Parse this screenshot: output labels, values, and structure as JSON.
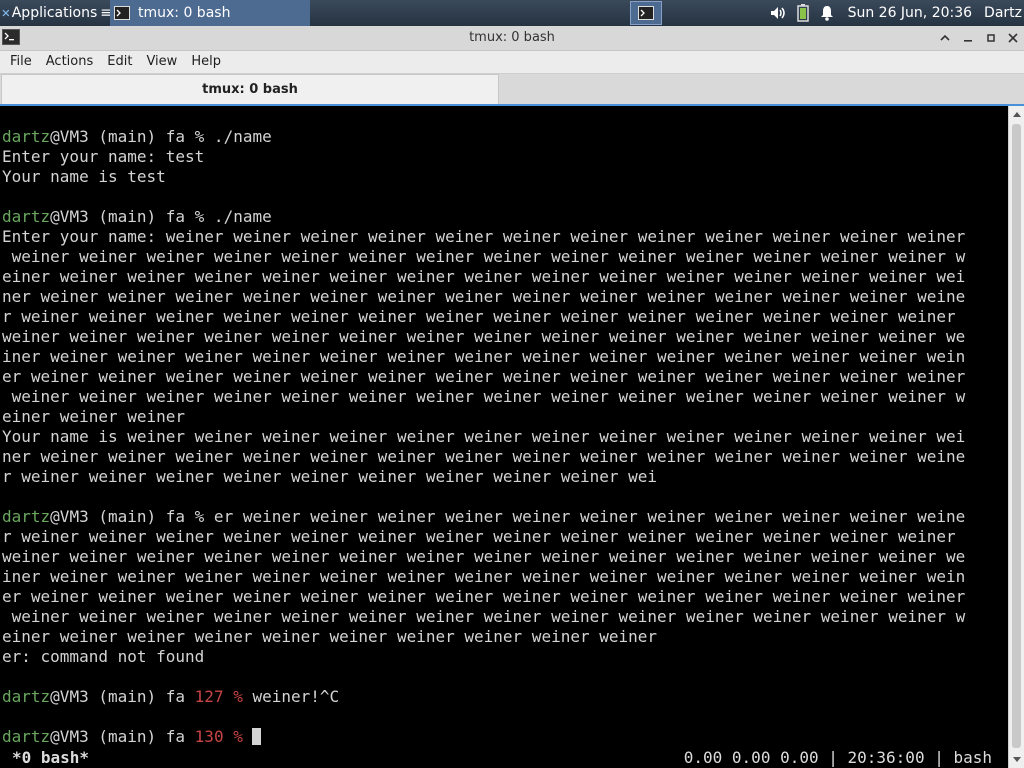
{
  "panel": {
    "apps_label": "Applications",
    "task_label": "tmux: 0 bash",
    "clock": "Sun 26 Jun, 20:36",
    "user": "Dartz",
    "icons": [
      "xfce-logo-icon",
      "terminal-icon",
      "volume-icon",
      "battery-icon",
      "notification-bell-icon"
    ]
  },
  "window": {
    "title": "tmux: 0 bash",
    "menu": [
      "File",
      "Actions",
      "Edit",
      "View",
      "Help"
    ],
    "tab_label": "tmux: 0 bash"
  },
  "terminal": {
    "lines": [
      {
        "segs": [
          {
            "t": "dartz",
            "c": "user"
          },
          {
            "t": "@VM3 (main) fa % ./name"
          }
        ]
      },
      {
        "segs": [
          {
            "t": "Enter your name: test"
          }
        ]
      },
      {
        "segs": [
          {
            "t": "Your name is test"
          }
        ]
      },
      {
        "segs": [
          {
            "t": ""
          }
        ]
      },
      {
        "segs": [
          {
            "t": "dartz",
            "c": "user"
          },
          {
            "t": "@VM3 (main) fa % ./name"
          }
        ]
      },
      {
        "segs": [
          {
            "t": "Enter your name: weiner weiner weiner weiner weiner weiner weiner weiner weiner weiner weiner weiner"
          }
        ]
      },
      {
        "segs": [
          {
            "t": " weiner weiner weiner weiner weiner weiner weiner weiner weiner weiner weiner weiner weiner weiner w"
          }
        ]
      },
      {
        "segs": [
          {
            "t": "einer weiner weiner weiner weiner weiner weiner weiner weiner weiner weiner weiner weiner weiner wei"
          }
        ]
      },
      {
        "segs": [
          {
            "t": "ner weiner weiner weiner weiner weiner weiner weiner weiner weiner weiner weiner weiner weiner weine"
          }
        ]
      },
      {
        "segs": [
          {
            "t": "r weiner weiner weiner weiner weiner weiner weiner weiner weiner weiner weiner weiner weiner weiner"
          }
        ]
      },
      {
        "segs": [
          {
            "t": "weiner weiner weiner weiner weiner weiner weiner weiner weiner weiner weiner weiner weiner weiner we"
          }
        ]
      },
      {
        "segs": [
          {
            "t": "iner weiner weiner weiner weiner weiner weiner weiner weiner weiner weiner weiner weiner weiner wein"
          }
        ]
      },
      {
        "segs": [
          {
            "t": "er weiner weiner weiner weiner weiner weiner weiner weiner weiner weiner weiner weiner weiner weiner"
          }
        ]
      },
      {
        "segs": [
          {
            "t": " weiner weiner weiner weiner weiner weiner weiner weiner weiner weiner weiner weiner weiner weiner w"
          }
        ]
      },
      {
        "segs": [
          {
            "t": "einer weiner weiner"
          }
        ]
      },
      {
        "segs": [
          {
            "t": "Your name is weiner weiner weiner weiner weiner weiner weiner weiner weiner weiner weiner weiner wei"
          }
        ]
      },
      {
        "segs": [
          {
            "t": "ner weiner weiner weiner weiner weiner weiner weiner weiner weiner weiner weiner weiner weiner weine"
          }
        ]
      },
      {
        "segs": [
          {
            "t": "r weiner weiner weiner weiner weiner weiner weiner weiner weiner wei"
          }
        ]
      },
      {
        "segs": [
          {
            "t": ""
          }
        ]
      },
      {
        "segs": [
          {
            "t": "dartz",
            "c": "user"
          },
          {
            "t": "@VM3 (main) fa % er weiner weiner weiner weiner weiner weiner weiner weiner weiner weiner weine"
          }
        ]
      },
      {
        "segs": [
          {
            "t": "r weiner weiner weiner weiner weiner weiner weiner weiner weiner weiner weiner weiner weiner weiner"
          }
        ]
      },
      {
        "segs": [
          {
            "t": "weiner weiner weiner weiner weiner weiner weiner weiner weiner weiner weiner weiner weiner weiner we"
          }
        ]
      },
      {
        "segs": [
          {
            "t": "iner weiner weiner weiner weiner weiner weiner weiner weiner weiner weiner weiner weiner weiner wein"
          }
        ]
      },
      {
        "segs": [
          {
            "t": "er weiner weiner weiner weiner weiner weiner weiner weiner weiner weiner weiner weiner weiner weiner"
          }
        ]
      },
      {
        "segs": [
          {
            "t": " weiner weiner weiner weiner weiner weiner weiner weiner weiner weiner weiner weiner weiner weiner w"
          }
        ]
      },
      {
        "segs": [
          {
            "t": "einer weiner weiner weiner weiner weiner weiner weiner weiner weiner"
          }
        ]
      },
      {
        "segs": [
          {
            "t": "er: command not found"
          }
        ]
      },
      {
        "segs": [
          {
            "t": ""
          }
        ]
      },
      {
        "segs": [
          {
            "t": "dartz",
            "c": "user"
          },
          {
            "t": "@VM3 (main) fa "
          },
          {
            "t": "127 %",
            "c": "err"
          },
          {
            "t": " weiner!^C"
          }
        ]
      },
      {
        "segs": [
          {
            "t": ""
          }
        ]
      },
      {
        "segs": [
          {
            "t": "dartz",
            "c": "user"
          },
          {
            "t": "@VM3 (main) fa "
          },
          {
            "t": "130 %",
            "c": "err"
          },
          {
            "t": " "
          },
          {
            "t": "",
            "c": "cursor"
          }
        ]
      }
    ],
    "status_left": "*0 bash*",
    "status_right": "0.00 0.00 0.00 | 20:36:00 | bash"
  },
  "colors": {
    "user": "#6aa65e",
    "error": "#c74545",
    "text": "#d4d4d4",
    "accent": "#4a90d9"
  }
}
